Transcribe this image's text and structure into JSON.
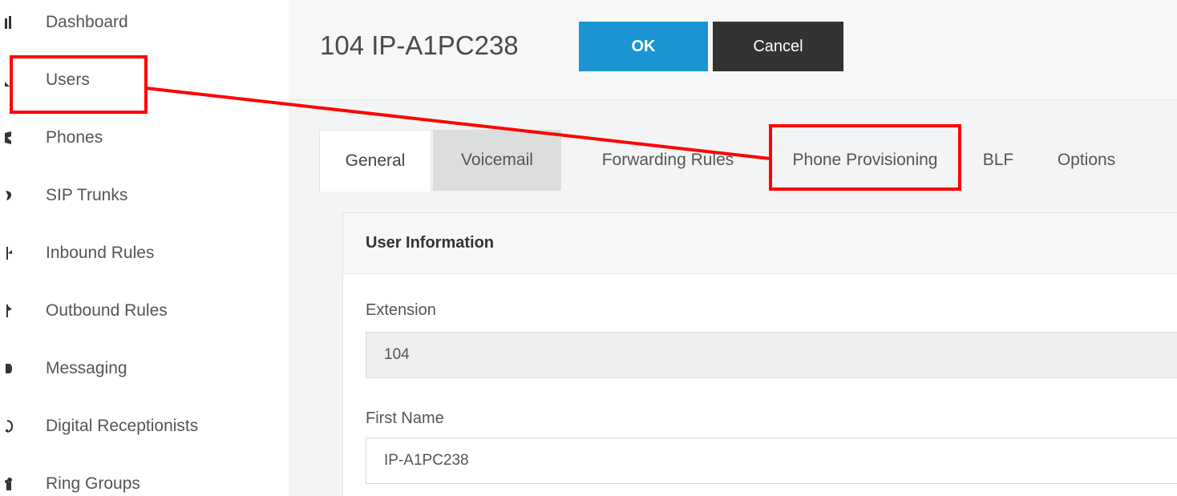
{
  "sidebar": {
    "items": [
      {
        "label": "Dashboard",
        "icon": "dashboard-icon"
      },
      {
        "label": "Users",
        "icon": "users-icon"
      },
      {
        "label": "Phones",
        "icon": "phone-icon"
      },
      {
        "label": "SIP Trunks",
        "icon": "sip-trunks-icon"
      },
      {
        "label": "Inbound Rules",
        "icon": "inbound-rules-icon"
      },
      {
        "label": "Outbound Rules",
        "icon": "outbound-rules-icon"
      },
      {
        "label": "Messaging",
        "icon": "messaging-icon"
      },
      {
        "label": "Digital Receptionists",
        "icon": "digital-receptionist-icon"
      },
      {
        "label": "Ring Groups",
        "icon": "ring-groups-icon"
      }
    ]
  },
  "header": {
    "title": "104 IP-A1PC238",
    "ok_label": "OK",
    "cancel_label": "Cancel"
  },
  "tabs": [
    {
      "label": "General",
      "state": "active"
    },
    {
      "label": "Voicemail",
      "state": "hover"
    },
    {
      "label": "Forwarding Rules",
      "state": "normal"
    },
    {
      "label": "Phone Provisioning",
      "state": "normal"
    },
    {
      "label": "BLF",
      "state": "normal"
    },
    {
      "label": "Options",
      "state": "normal"
    }
  ],
  "panel": {
    "title": "User Information",
    "fields": [
      {
        "label": "Extension",
        "value": "104",
        "readonly": true
      },
      {
        "label": "First Name",
        "value": "IP-A1PC238",
        "readonly": false
      }
    ]
  },
  "colors": {
    "ok_button": "#1a94d2",
    "cancel_button": "#333333",
    "annotation": "#ff0000"
  }
}
